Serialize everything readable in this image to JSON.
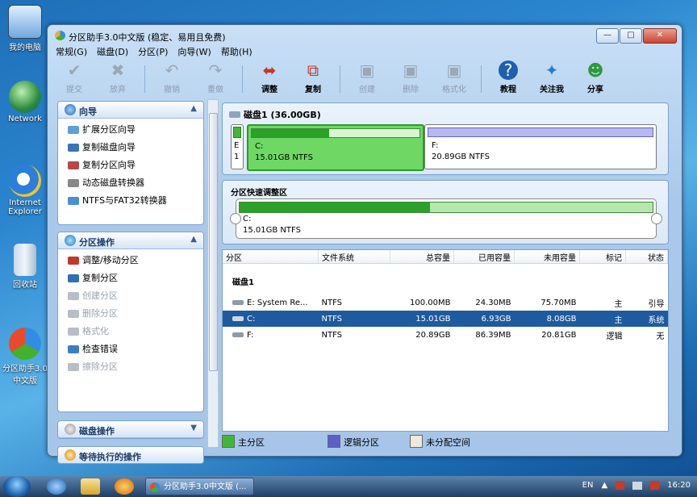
{
  "desktop": {
    "icons": [
      "我的电脑",
      "Network",
      "Internet Explorer",
      "回收站",
      "分区助手3.0中文版"
    ]
  },
  "window": {
    "title": "分区助手3.0中文版 (稳定、易用且免费)",
    "controls": {
      "minimize": "—",
      "maximize": "□",
      "close": "✕"
    }
  },
  "menu": [
    "常规(G)",
    "磁盘(D)",
    "分区(P)",
    "向导(W)",
    "帮助(H)"
  ],
  "toolbar": [
    {
      "label": "提交",
      "icon": "check-icon",
      "enabled": false
    },
    {
      "label": "放弃",
      "icon": "x-icon",
      "enabled": false
    },
    {
      "label": "撤销",
      "icon": "undo-icon",
      "enabled": false
    },
    {
      "label": "重做",
      "icon": "redo-icon",
      "enabled": false
    },
    {
      "label": "调整",
      "icon": "resize-disk-icon",
      "enabled": true
    },
    {
      "label": "复制",
      "icon": "copy-disk-icon",
      "enabled": true
    },
    {
      "label": "创建",
      "icon": "create-disk-icon",
      "enabled": false
    },
    {
      "label": "删除",
      "icon": "delete-disk-icon",
      "enabled": false
    },
    {
      "label": "格式化",
      "icon": "format-disk-icon",
      "enabled": false
    },
    {
      "label": "教程",
      "icon": "help-icon",
      "enabled": true
    },
    {
      "label": "关注我",
      "icon": "follow-icon",
      "enabled": true
    },
    {
      "label": "分享",
      "icon": "share-icon",
      "enabled": true
    }
  ],
  "wizard_panel": {
    "title": "向导",
    "items": [
      "扩展分区向导",
      "复制磁盘向导",
      "复制分区向导",
      "动态磁盘转换器",
      "NTFS与FAT32转换器"
    ]
  },
  "partition_ops": {
    "title": "分区操作",
    "items": [
      {
        "label": "调整/移动分区",
        "enabled": true
      },
      {
        "label": "复制分区",
        "enabled": true
      },
      {
        "label": "创建分区",
        "enabled": false
      },
      {
        "label": "删除分区",
        "enabled": false
      },
      {
        "label": "格式化",
        "enabled": false
      },
      {
        "label": "检查错误",
        "enabled": true
      },
      {
        "label": "擦除分区",
        "enabled": false
      }
    ]
  },
  "disk_ops": {
    "title": "磁盘操作"
  },
  "pending_ops": {
    "title": "等待执行的操作"
  },
  "disk_map": {
    "title": "磁盘1 (36.00GB)",
    "segments": [
      {
        "letter": "E",
        "num": "1",
        "name": "",
        "size": ""
      },
      {
        "letter": "C:",
        "size": "15.01GB NTFS",
        "used_fraction": 0.46
      },
      {
        "letter": "F:",
        "size": "20.89GB NTFS",
        "used_fraction": 0.0
      }
    ]
  },
  "quick_adjust": {
    "title": "分区快速调整区",
    "letter": "C:",
    "size": "15.01GB NTFS",
    "used_fraction": 0.46
  },
  "table": {
    "columns": [
      "分区",
      "文件系统",
      "总容量",
      "已用容量",
      "未用容量",
      "标记",
      "状态"
    ],
    "group": "磁盘1",
    "rows": [
      {
        "name": "E: System Re...",
        "fs": "NTFS",
        "total": "100.00MB",
        "used": "24.30MB",
        "free": "75.70MB",
        "flag": "主",
        "status": "引导",
        "selected": false
      },
      {
        "name": "C:",
        "fs": "NTFS",
        "total": "15.01GB",
        "used": "6.93GB",
        "free": "8.08GB",
        "flag": "主",
        "status": "系统",
        "selected": true
      },
      {
        "name": "F:",
        "fs": "NTFS",
        "total": "20.89GB",
        "used": "86.39MB",
        "free": "20.81GB",
        "flag": "逻辑",
        "status": "无",
        "selected": false
      }
    ]
  },
  "legend": [
    {
      "label": "主分区",
      "color": "#3fb83a"
    },
    {
      "label": "逻辑分区",
      "color": "#5d5fc8"
    },
    {
      "label": "未分配空间",
      "color": "#efe9dd"
    }
  ],
  "taskbar": {
    "task": "分区助手3.0中文版 (...",
    "lang": "EN",
    "time": "16:20"
  },
  "colors": {
    "primary_green": "#3fb83a",
    "selection_blue": "#1f5a9e",
    "logical_purple": "#5d5fc8"
  }
}
